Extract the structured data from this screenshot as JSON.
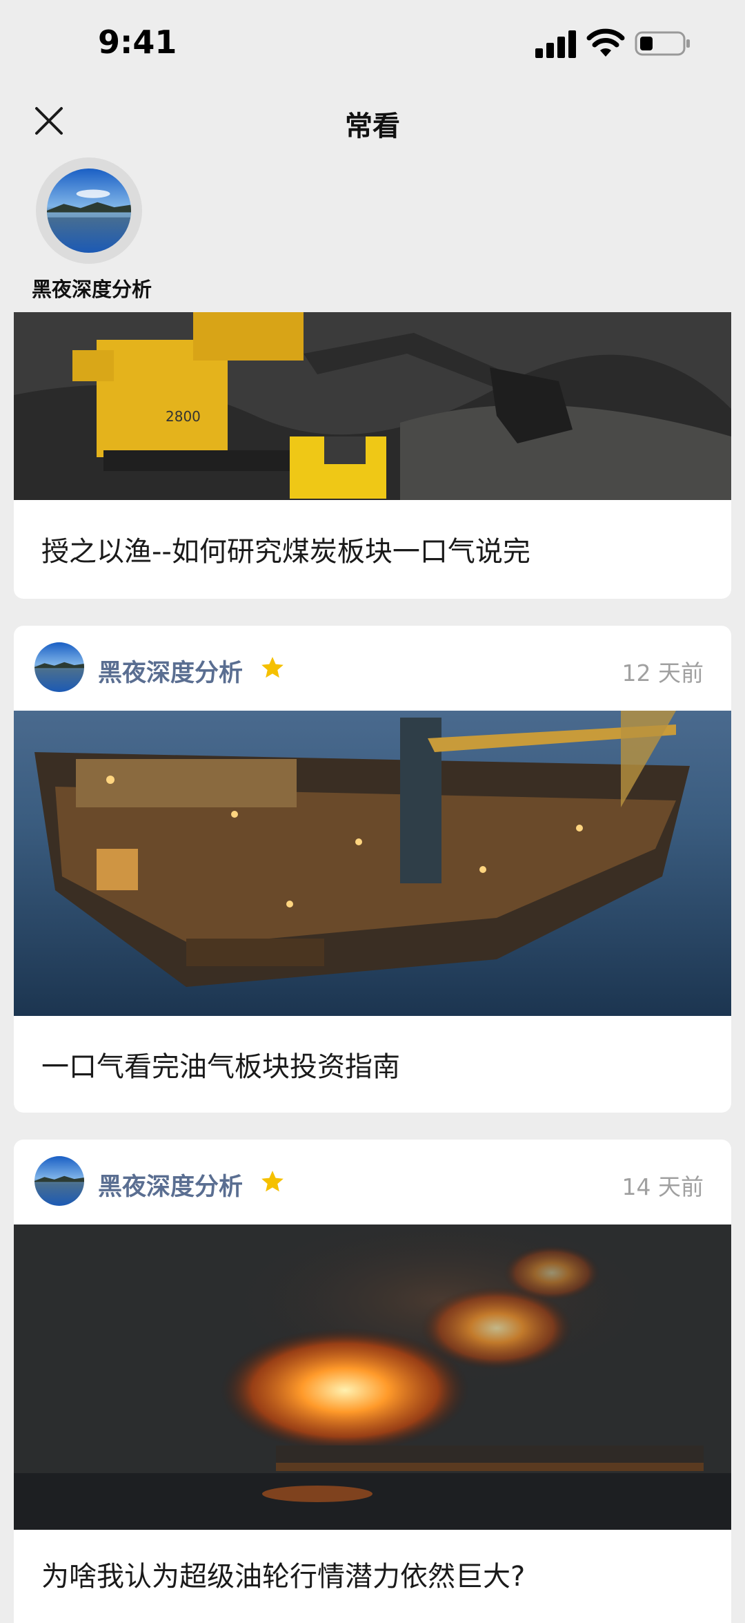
{
  "status_bar": {
    "time": "9:41"
  },
  "nav": {
    "title": "常看"
  },
  "favorite_account": {
    "name": "黑夜深度分析"
  },
  "articles": [
    {
      "title": "授之以渔--如何研究煤炭板块一口气说完",
      "image": "coal-mining-excavator"
    },
    {
      "author": "黑夜深度分析",
      "time": "12 天前",
      "title": "一口气看完油气板块投资指南",
      "image": "offshore-oil-platform"
    },
    {
      "author": "黑夜深度分析",
      "time": "14 天前",
      "title": "为啥我认为超级油轮行情潜力依然巨大?",
      "image": "burning-oil-tanker"
    }
  ],
  "colors": {
    "background": "#ededed",
    "author": "#5a6e91",
    "star": "#f5c000",
    "time": "#a0a0a0"
  }
}
